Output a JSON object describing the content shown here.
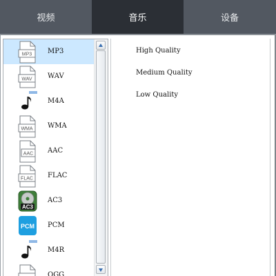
{
  "tabs": [
    {
      "label": "视频",
      "active": false
    },
    {
      "label": "音乐",
      "active": true
    },
    {
      "label": "设备",
      "active": false
    }
  ],
  "formats": [
    {
      "label": "MP3",
      "icon": "mp3-file-icon",
      "badge": "MP3",
      "selected": true
    },
    {
      "label": "WAV",
      "icon": "wav-file-icon",
      "badge": "WAV",
      "selected": false
    },
    {
      "label": "M4A",
      "icon": "m4a-music-note-icon",
      "badge": "",
      "selected": false
    },
    {
      "label": "WMA",
      "icon": "wma-file-icon",
      "badge": "WMA",
      "selected": false
    },
    {
      "label": "AAC",
      "icon": "aac-file-icon",
      "badge": "AAC",
      "selected": false
    },
    {
      "label": "FLAC",
      "icon": "flac-file-icon",
      "badge": "FLAC",
      "selected": false
    },
    {
      "label": "AC3",
      "icon": "ac3-disc-icon",
      "badge": "AC3",
      "selected": false
    },
    {
      "label": "PCM",
      "icon": "pcm-badge-icon",
      "badge": "PCM",
      "selected": false
    },
    {
      "label": "M4R",
      "icon": "m4r-music-note-icon",
      "badge": "",
      "selected": false
    },
    {
      "label": "OGG",
      "icon": "ogg-file-icon",
      "badge": "",
      "selected": false
    }
  ],
  "qualities": [
    {
      "label": "High Quality"
    },
    {
      "label": "Medium Quality"
    },
    {
      "label": "Low Quality"
    }
  ],
  "colors": {
    "tab_bar": "#525861",
    "tab_active": "#2b2f35",
    "selection": "#cce8ff",
    "pcm_blue": "#1e9fe0",
    "ac3_green": "#3f7f3a"
  }
}
